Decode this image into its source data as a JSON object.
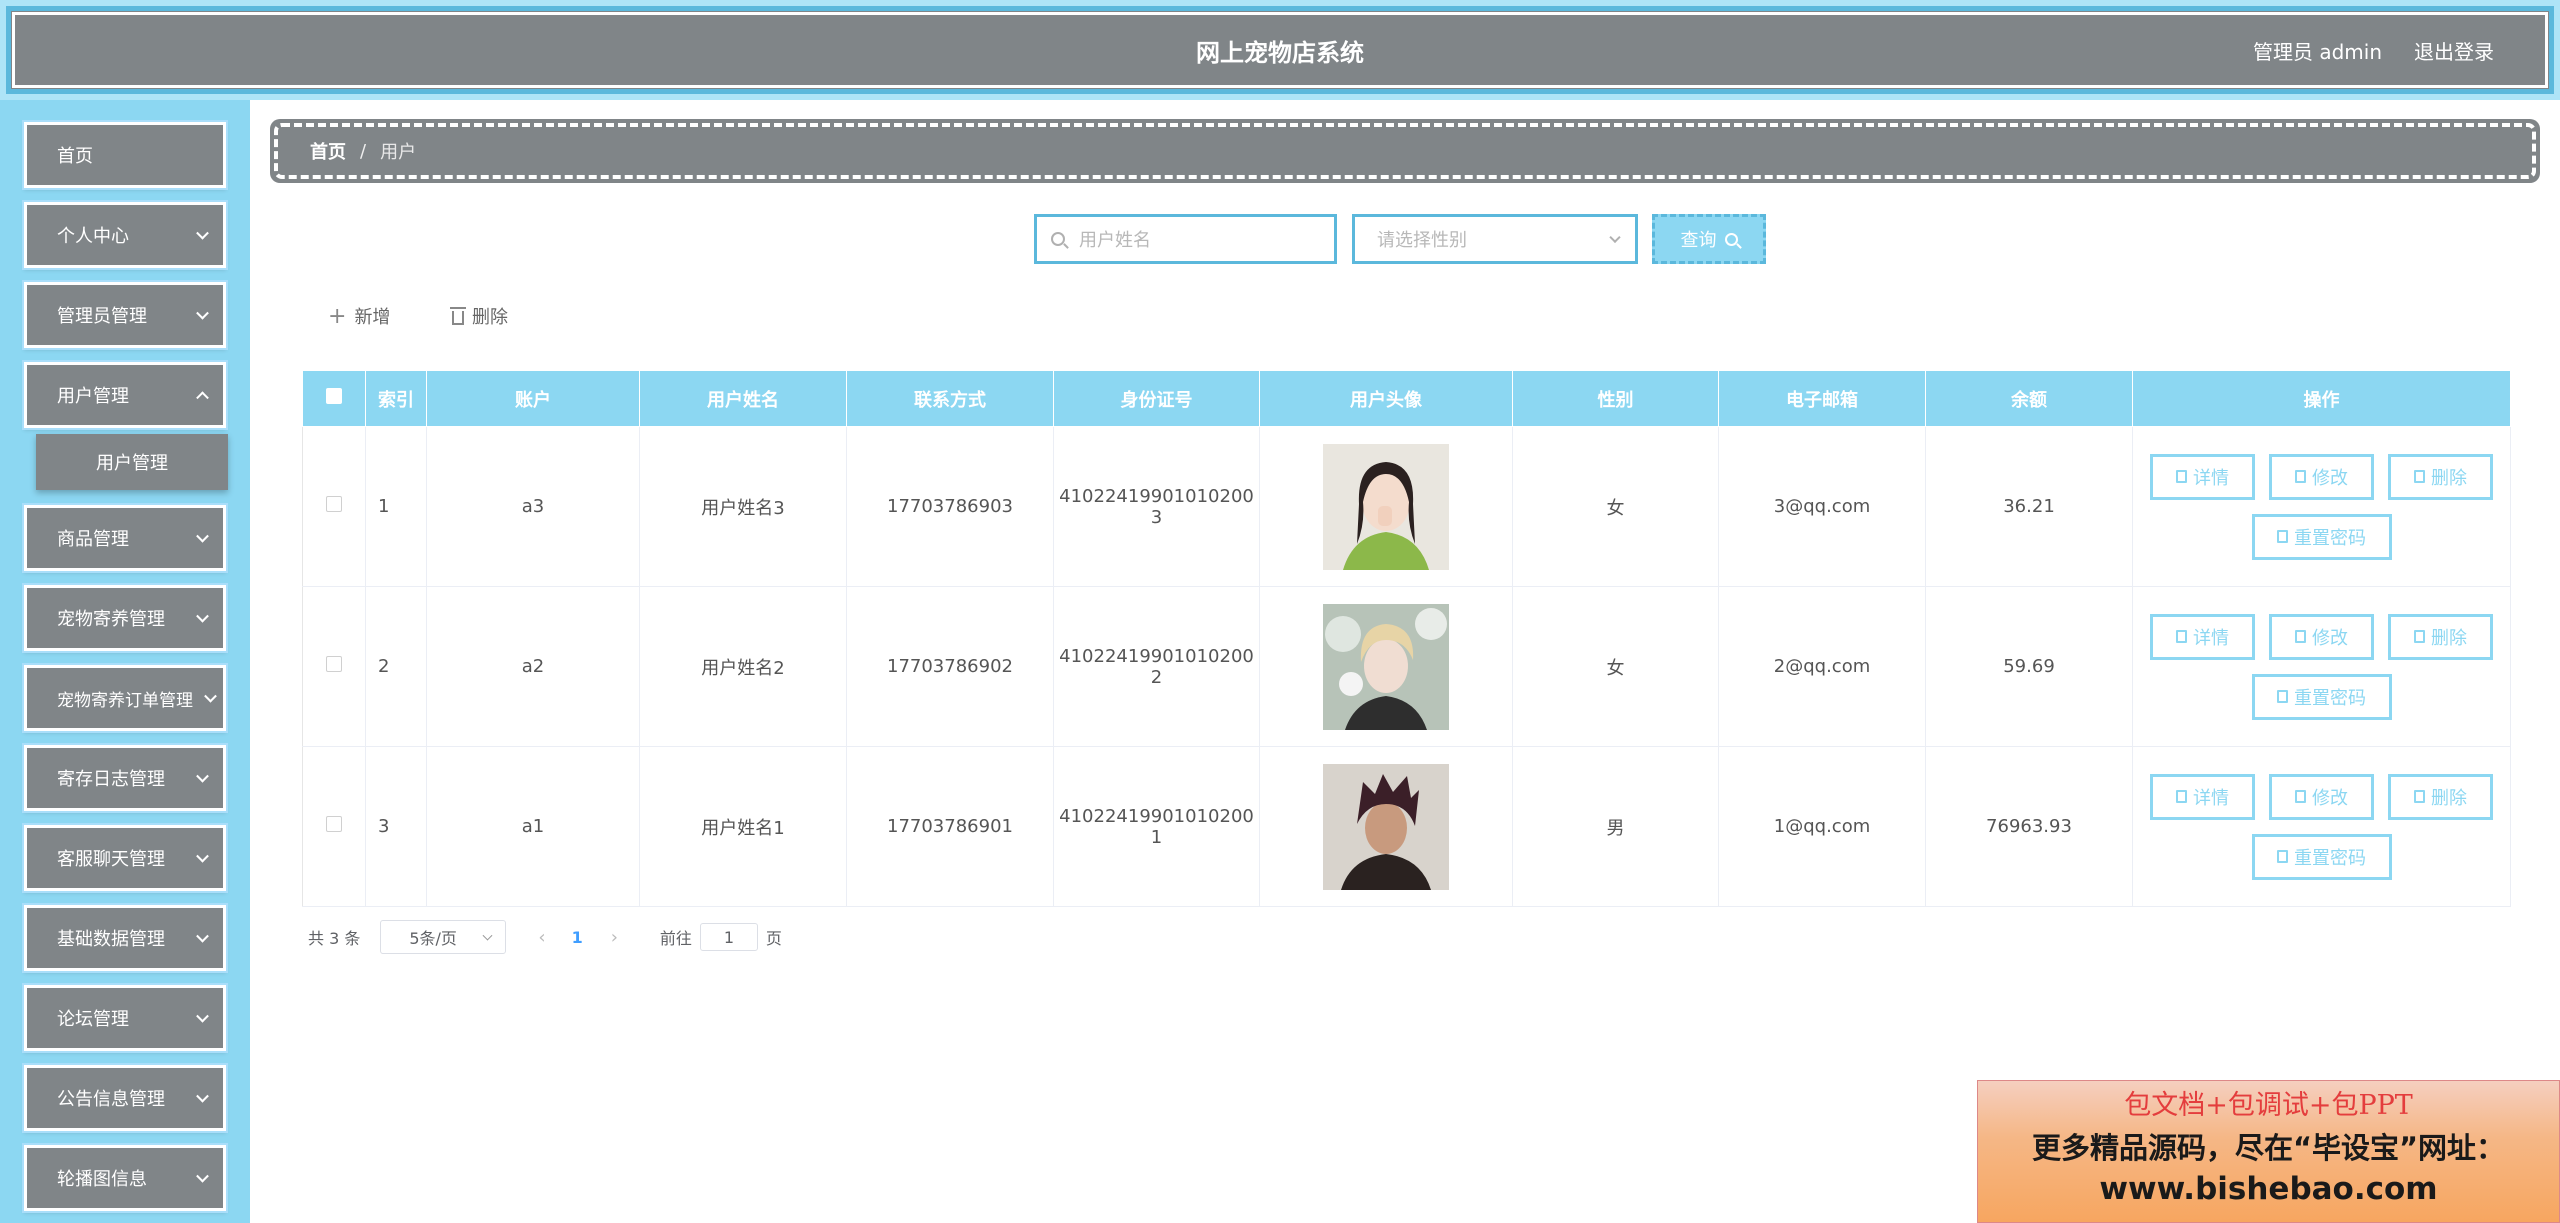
{
  "header": {
    "title": "网上宠物店系统",
    "user_label": "管理员 admin",
    "logout": "退出登录"
  },
  "sidebar": {
    "items": [
      {
        "label": "首页"
      },
      {
        "label": "个人中心"
      },
      {
        "label": "管理员管理"
      },
      {
        "label": "用户管理"
      },
      {
        "label": "商品管理"
      },
      {
        "label": "宠物寄养管理"
      },
      {
        "label": "宠物寄养订单管理"
      },
      {
        "label": "寄存日志管理"
      },
      {
        "label": "客服聊天管理"
      },
      {
        "label": "基础数据管理"
      },
      {
        "label": "论坛管理"
      },
      {
        "label": "公告信息管理"
      },
      {
        "label": "轮播图信息"
      }
    ],
    "submenu": {
      "label": "用户管理"
    }
  },
  "breadcrumb": {
    "home": "首页",
    "separator": "/",
    "current": "用户"
  },
  "search": {
    "name_placeholder": "用户姓名",
    "gender_placeholder": "请选择性别",
    "query": "查询"
  },
  "actions": {
    "add": "新增",
    "delete": "删除"
  },
  "table": {
    "headers": [
      "索引",
      "账户",
      "用户姓名",
      "联系方式",
      "身份证号",
      "用户头像",
      "性别",
      "电子邮箱",
      "余额",
      "操作"
    ],
    "rows": [
      {
        "index": "1",
        "account": "a3",
        "name": "用户姓名3",
        "phone": "17703786903",
        "id_line1": "41022419901010200",
        "id_line2": "3",
        "gender": "女",
        "email": "3@qq.com",
        "balance": "36.21"
      },
      {
        "index": "2",
        "account": "a2",
        "name": "用户姓名2",
        "phone": "17703786902",
        "id_line1": "41022419901010200",
        "id_line2": "2",
        "gender": "女",
        "email": "2@qq.com",
        "balance": "59.69"
      },
      {
        "index": "3",
        "account": "a1",
        "name": "用户姓名1",
        "phone": "17703786901",
        "id_line1": "41022419901010200",
        "id_line2": "1",
        "gender": "男",
        "email": "1@qq.com",
        "balance": "76963.93"
      }
    ],
    "ops": {
      "detail": "详情",
      "edit": "修改",
      "delete": "删除",
      "reset": "重置密码"
    }
  },
  "pagination": {
    "total": "共 3 条",
    "page_size": "5条/页",
    "current": "1",
    "goto_label": "前往",
    "goto_value": "1",
    "goto_suffix": "页"
  },
  "promo": {
    "line1": "包文档+包调试+包PPT",
    "line2": "更多精品源码，尽在“毕设宝”网址：",
    "line3": "www.bishebao.com"
  },
  "colors": {
    "accent": "#8cd7f2",
    "header_bg": "#808588",
    "border": "#5bb8dc"
  }
}
